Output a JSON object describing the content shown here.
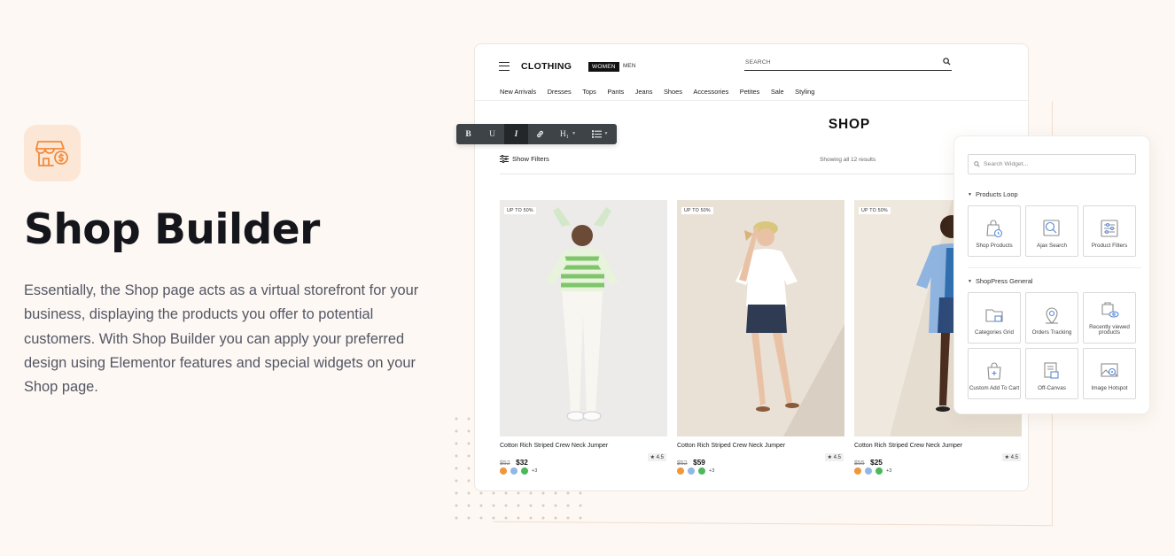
{
  "hero": {
    "title": "Shop Builder",
    "description": "Essentially, the Shop page acts as a virtual storefront for your business, displaying the products you offer to potential customers. With Shop Builder you can apply your preferred design using Elementor features and special widgets on your Shop page.",
    "icon": "storefront-dollar-icon",
    "accent_color": "#f28b3c"
  },
  "shop": {
    "brand": "CLOTHING",
    "gender_tabs": [
      "WOMEN",
      "MEN"
    ],
    "search_placeholder": "SEARCH",
    "nav_items": [
      "New Arrivals",
      "Dresses",
      "Tops",
      "Pants",
      "Jeans",
      "Shoes",
      "Accessories",
      "Petites",
      "Sale",
      "Styling"
    ],
    "page_title": "SHOP",
    "filters_label": "Show Filters",
    "result_count": "Showing all 12 results",
    "products": [
      {
        "badge": "UP TO 50%",
        "name": "Cotton Rich Striped Crew Neck Jumper",
        "old_price": "$52",
        "price": "$32",
        "rating": "★ 4.5",
        "more_colors": "+3"
      },
      {
        "badge": "UP TO 50%",
        "name": "Cotton Rich Striped Crew Neck Jumper",
        "old_price": "$52",
        "price": "$59",
        "rating": "★ 4.5",
        "more_colors": "+3"
      },
      {
        "badge": "UP TO 50%",
        "name": "Cotton Rich Striped Crew Neck Jumper",
        "old_price": "$55",
        "price": "$25",
        "rating": "★ 4.5",
        "more_colors": "+3"
      }
    ],
    "swatch_colors": [
      "#f0963b",
      "#8fb8e6",
      "#4cb85c"
    ]
  },
  "toolbar": {
    "bold": "B",
    "underline": "U",
    "italic": "I",
    "link": "link-icon",
    "heading": "H₁",
    "list": "list-icon"
  },
  "panel": {
    "search_placeholder": "Search Widget...",
    "sections": [
      {
        "title": "Products Loop",
        "widgets": [
          "Shop Products",
          "Ajax Search",
          "Product Filters"
        ]
      },
      {
        "title": "ShopPress General",
        "widgets": [
          "Categories Grid",
          "Orders Tracking",
          "Recently viewed products",
          "Custom Add To Cart",
          "Off-Canvas",
          "Image Hotspot"
        ]
      }
    ]
  }
}
